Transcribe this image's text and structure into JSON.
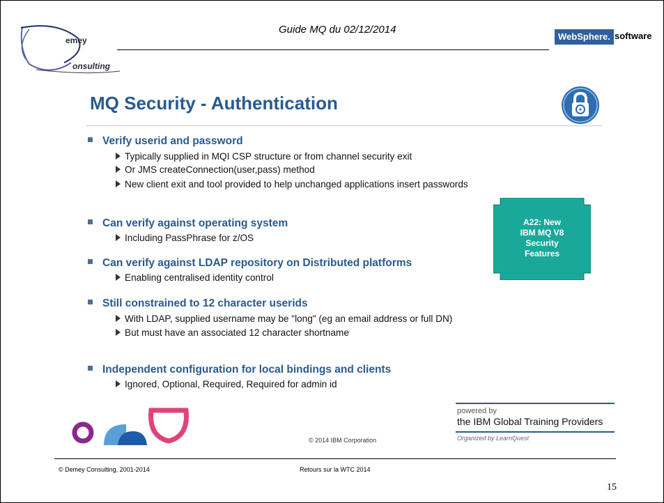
{
  "header": {
    "title": "Guide MQ du 02/12/2014",
    "logo_word_1": "emey",
    "logo_word_2": "onsulting",
    "websphere_badge": "WebSphere.",
    "websphere_software": "software"
  },
  "slide": {
    "title": "MQ Security - Authentication",
    "bullets": [
      {
        "text": "Verify userid and password",
        "subs": [
          "Typically supplied in MQI CSP structure or from channel security exit",
          "Or JMS createConnection(user,pass) method",
          "New client exit and tool provided to help unchanged applications insert passwords"
        ]
      },
      {
        "text": "Can verify against operating system",
        "subs": [
          "Including PassPhrase for z/OS"
        ]
      },
      {
        "text": "Can verify against LDAP repository on Distributed platforms",
        "subs": [
          "Enabling centralised identity control"
        ]
      },
      {
        "text": "Still constrained to 12 character userids",
        "subs": [
          "With LDAP, supplied username may be \"long\" (eg an email address or full DN)",
          "But must have an associated 12 character shortname"
        ]
      },
      {
        "text": "Independent configuration for local bindings and clients",
        "subs": [
          "Ignored, Optional, Required, Required for admin id"
        ]
      }
    ],
    "session_box": {
      "line1": "A22: New",
      "line2": "IBM MQ V8",
      "line3": "Security",
      "line4": "Features"
    },
    "copyright": "© 2014 IBM Corporation",
    "powered_by": {
      "line1": "powered by",
      "line2": "the IBM Global Training Providers",
      "line3": "Organized by LearnQuest"
    },
    "colors": {
      "title": "#2a5a8f",
      "session_box": "#1aa89a",
      "websphere": "#2f5f9e"
    },
    "icons": [
      "lock-icon"
    ]
  },
  "footer": {
    "left": "© Demey Consulting, 2001-2014",
    "center": "Retours sur la WTC 2014",
    "page_number": "15"
  }
}
